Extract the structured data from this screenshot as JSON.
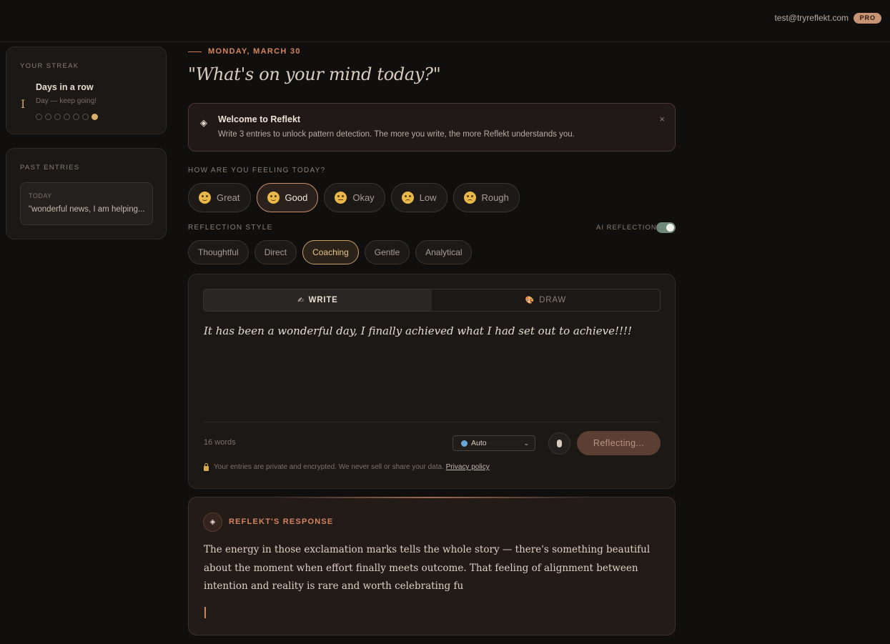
{
  "header": {
    "email": "test@tryreflekt.com",
    "plan_badge": "PRO"
  },
  "sidebar": {
    "streak": {
      "label": "YOUR STREAK",
      "icon_glyph": "I",
      "title": "Days in a row",
      "subtitle": "Day — keep going!",
      "days_total": 7,
      "days_active": 1
    },
    "past_entries": {
      "label": "PAST ENTRIES",
      "items": [
        {
          "date": "TODAY",
          "preview": "\"wonderful news, I am helping..."
        }
      ]
    }
  },
  "main": {
    "date": "MONDAY, MARCH 30",
    "prompt": "\"What's on your mind today?\"",
    "welcome": {
      "title": "Welcome to Reflekt",
      "body": "Write 3 entries to unlock pattern detection. The more you write, the more Reflekt understands you.",
      "icon": "diamond-icon",
      "close": "×"
    },
    "mood": {
      "label": "HOW ARE YOU FEELING TODAY?",
      "selected": "Good",
      "options": [
        {
          "label": "Great",
          "face": "happy"
        },
        {
          "label": "Good",
          "face": "smile"
        },
        {
          "label": "Okay",
          "face": "neutral"
        },
        {
          "label": "Low",
          "face": "sad"
        },
        {
          "label": "Rough",
          "face": "sad"
        }
      ]
    },
    "reflection_style": {
      "label": "REFLECTION STYLE",
      "ai_label": "AI REFLECTIONS",
      "ai_enabled": true,
      "selected": "Coaching",
      "options": [
        "Thoughtful",
        "Direct",
        "Coaching",
        "Gentle",
        "Analytical"
      ]
    },
    "editor": {
      "tabs": [
        {
          "label": "WRITE",
          "icon": "✍",
          "active": true
        },
        {
          "label": "DRAW",
          "icon": "🎨",
          "active": false
        }
      ],
      "text": "It has been a wonderful day, I finally achieved what I had set out to achieve!!!!",
      "word_count": "16 words",
      "language": "Auto",
      "submit_label": "Reflecting...",
      "privacy_text": "Your entries are private and encrypted. We never sell or share your data.",
      "privacy_link": "Privacy policy"
    },
    "response": {
      "title": "REFLEKT'S RESPONSE",
      "icon": "◈",
      "body": "The energy in those exclamation marks tells the whole story — there's something beautiful about the moment when effort finally meets outcome. That feeling of alignment between intention and reality is rare and worth celebrating fu"
    }
  },
  "colors": {
    "accent": "#d4845d",
    "gold": "#d9ae6c",
    "background": "#110f0e",
    "card": "#1b1816"
  }
}
